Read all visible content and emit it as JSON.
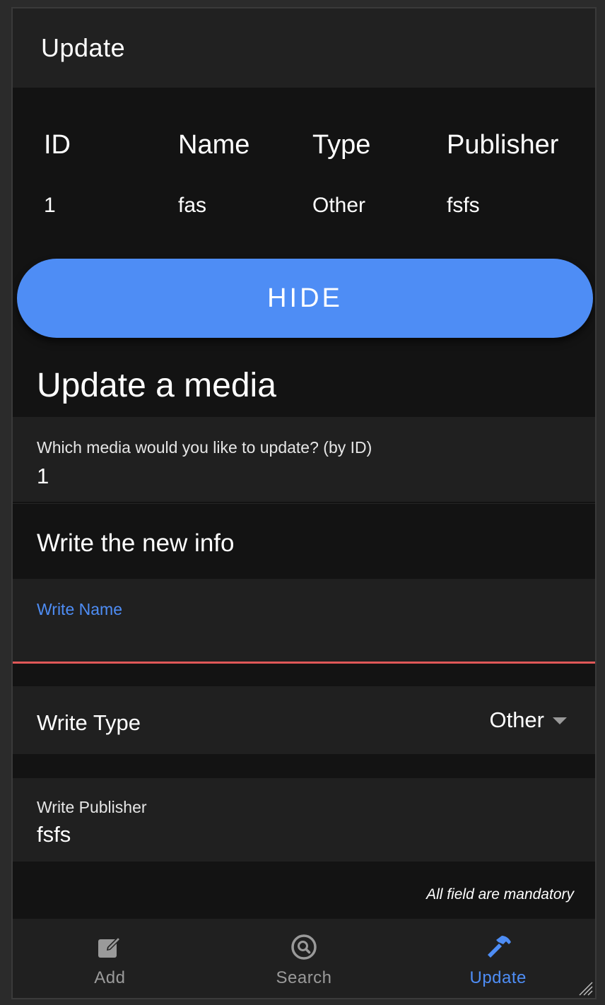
{
  "header": {
    "title": "Update"
  },
  "table": {
    "columns": [
      "ID",
      "Name",
      "Type",
      "Publisher"
    ],
    "rows": [
      [
        "1",
        "fas",
        "Other",
        "fsfs"
      ]
    ]
  },
  "hide_button": {
    "label": "HIDE"
  },
  "form": {
    "section_title": "Update a media",
    "id_field": {
      "label": "Which media would you like to update? (by ID)",
      "value": "1"
    },
    "subheading": "Write the new info",
    "name_field": {
      "label": "Write Name",
      "value": ""
    },
    "type_field": {
      "label": "Write Type",
      "selected": "Other"
    },
    "publisher_field": {
      "label": "Write Publisher",
      "value": "fsfs"
    },
    "mandatory_note": "All field are mandatory"
  },
  "nav": {
    "items": [
      {
        "label": "Add",
        "icon": "edit-icon",
        "active": false
      },
      {
        "label": "Search",
        "icon": "search-icon",
        "active": false
      },
      {
        "label": "Update",
        "icon": "hammer-icon",
        "active": true
      }
    ]
  },
  "colors": {
    "accent": "#4e8df5",
    "error_underline": "#e05858",
    "background": "#131313",
    "surface": "#202020",
    "inactive": "#9a9a9a"
  }
}
